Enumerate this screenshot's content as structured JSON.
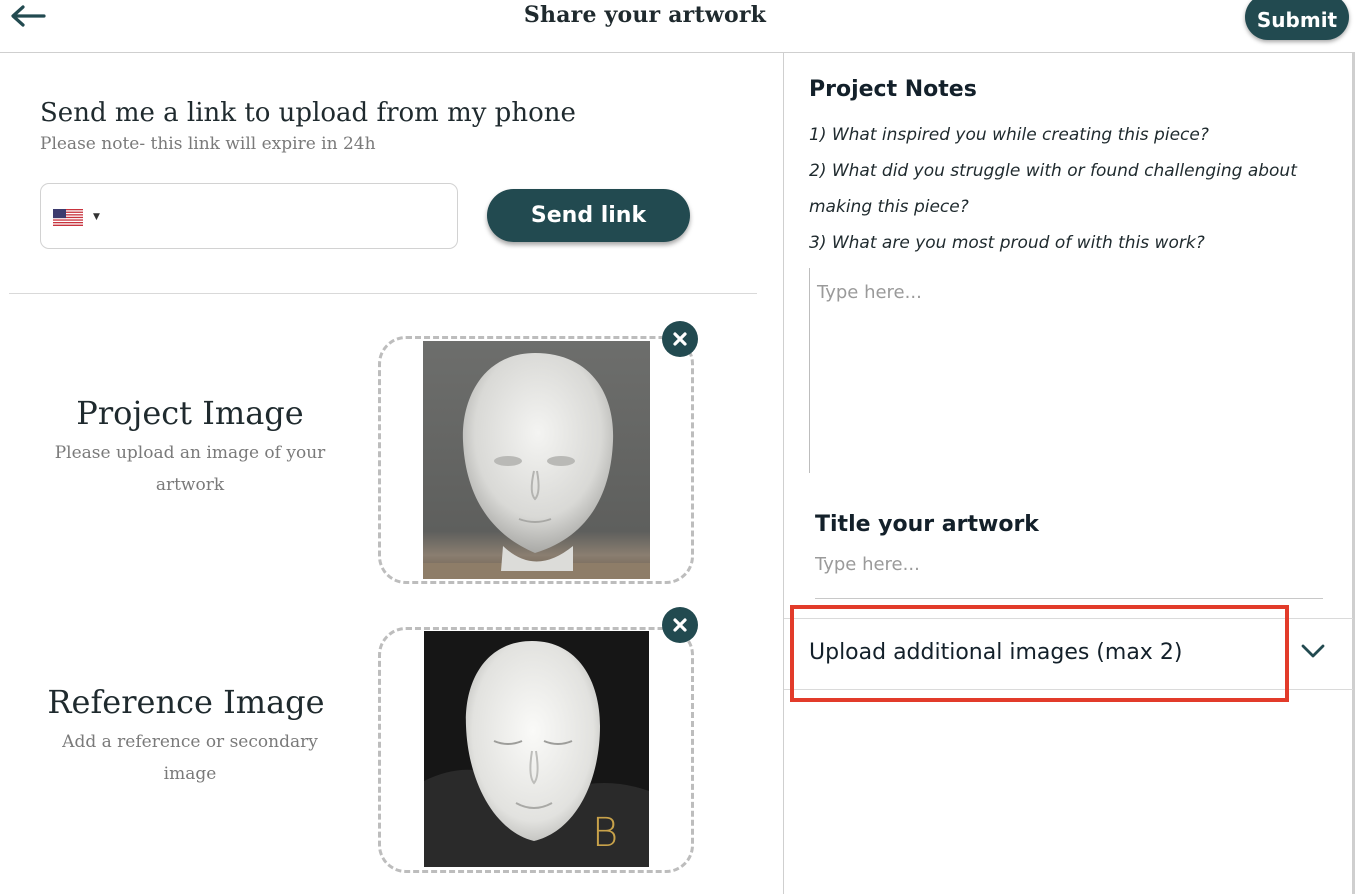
{
  "header": {
    "back_icon": "arrow-left-icon",
    "title": "Share your artwork",
    "submit_label": "Submit"
  },
  "phone_upload": {
    "heading": "Send me a link to upload from my phone",
    "note": "Please note- this link will expire in 24h",
    "country_flag": "us-flag-icon",
    "phone_value": "",
    "send_link_label": "Send link"
  },
  "project_image": {
    "title": "Project Image",
    "subtitle": "Please upload an image of your artwork",
    "remove_icon": "close-icon"
  },
  "reference_image": {
    "title": "Reference Image",
    "subtitle": "Add a reference or secondary image",
    "remove_icon": "close-icon",
    "photo_mark": "B"
  },
  "notes": {
    "heading": "Project Notes",
    "prompts": [
      "1) What inspired you while creating this piece?",
      "2) What did you struggle with or found challenging about making this piece?",
      "3) What are you most proud of with this work?"
    ],
    "placeholder": "Type here..."
  },
  "title_field": {
    "heading": "Title your artwork",
    "placeholder": "Type here..."
  },
  "additional_images": {
    "label": "Upload additional images (max 2)",
    "chevron_icon": "chevron-down-icon"
  },
  "colors": {
    "primary": "#224a50",
    "highlight": "#e23b2a"
  }
}
